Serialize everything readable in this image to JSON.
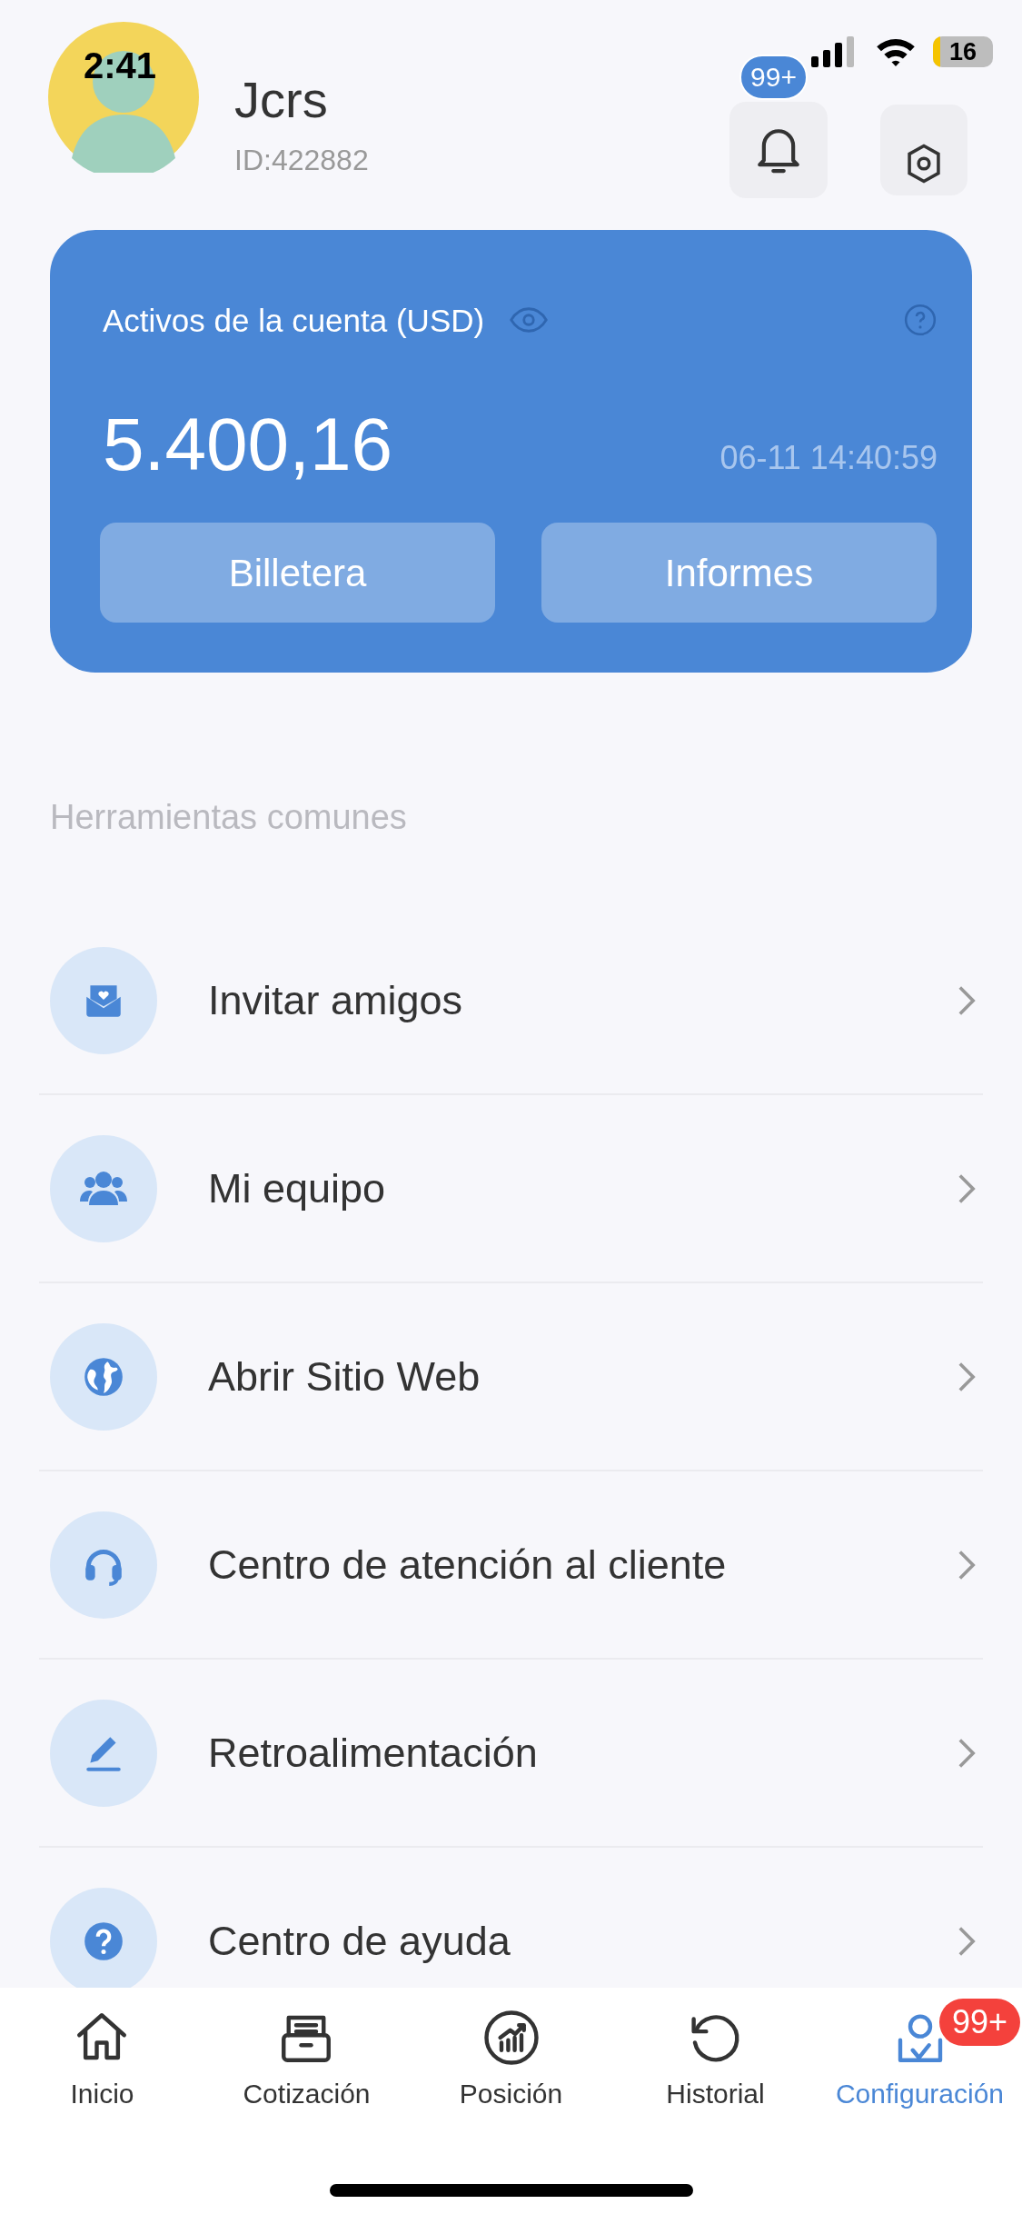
{
  "status_bar": {
    "time": "2:41",
    "battery": "16"
  },
  "profile": {
    "name": "Jcrs",
    "id": "ID:422882",
    "notifications_badge": "99+"
  },
  "account_card": {
    "title": "Activos de la cuenta (USD)",
    "balance": "5.400,16",
    "timestamp": "06-11 14:40:59",
    "buttons": [
      "Billetera",
      "Informes"
    ]
  },
  "section_title": "Herramientas comunes",
  "tools": [
    {
      "kind": "invite",
      "label": "Invitar amigos"
    },
    {
      "kind": "team",
      "label": "Mi equipo"
    },
    {
      "kind": "web",
      "label": "Abrir Sitio Web"
    },
    {
      "kind": "support",
      "label": "Centro de atención al cliente"
    },
    {
      "kind": "feedback",
      "label": "Retroalimentación"
    },
    {
      "kind": "help",
      "label": "Centro de ayuda"
    }
  ],
  "tab_bar": [
    {
      "kind": "home",
      "label": "Inicio",
      "selected": false
    },
    {
      "kind": "quote",
      "label": "Cotización",
      "selected": false
    },
    {
      "kind": "position",
      "label": "Posición",
      "selected": false
    },
    {
      "kind": "history",
      "label": "Historial",
      "selected": false
    },
    {
      "kind": "settings",
      "label": "Configuración",
      "selected": true,
      "badge": "99+"
    }
  ]
}
